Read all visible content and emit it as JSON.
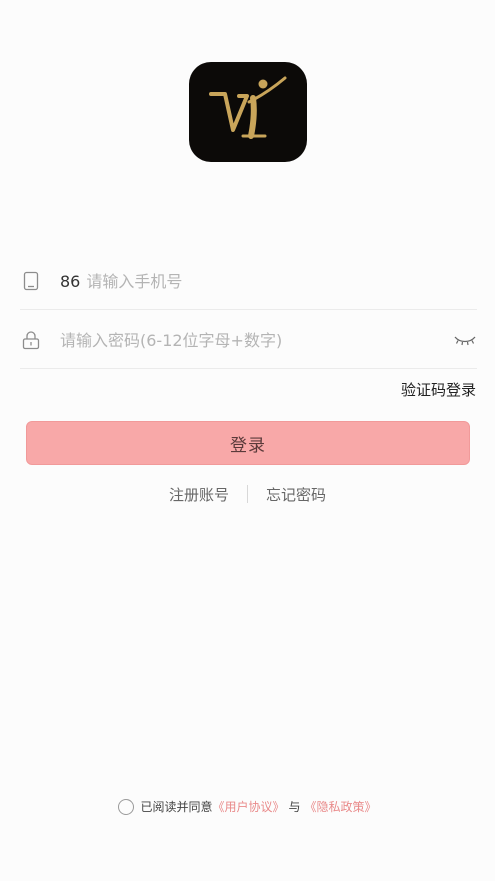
{
  "login": {
    "country_code": "86",
    "phone_placeholder": "请输入手机号",
    "password_placeholder": "请输入密码(6-12位字母+数字)",
    "sms_login_label": "验证码登录",
    "login_button_label": "登录",
    "register_label": "注册账号",
    "forgot_password_label": "忘记密码"
  },
  "agreement": {
    "prefix": "已阅读并同意",
    "user_agreement": "《用户协议》",
    "conjunction": "与",
    "privacy_policy": "《隐私政策》"
  },
  "icons": {
    "logo": "app-logo-vi",
    "phone": "phone-icon",
    "lock": "lock-icon",
    "eye": "eye-closed-icon"
  },
  "colors": {
    "login_button": "#f8a8a8",
    "policy_link": "#e98a8a",
    "logo_bg": "#0c0a08",
    "logo_gold": "#c9a55a"
  }
}
